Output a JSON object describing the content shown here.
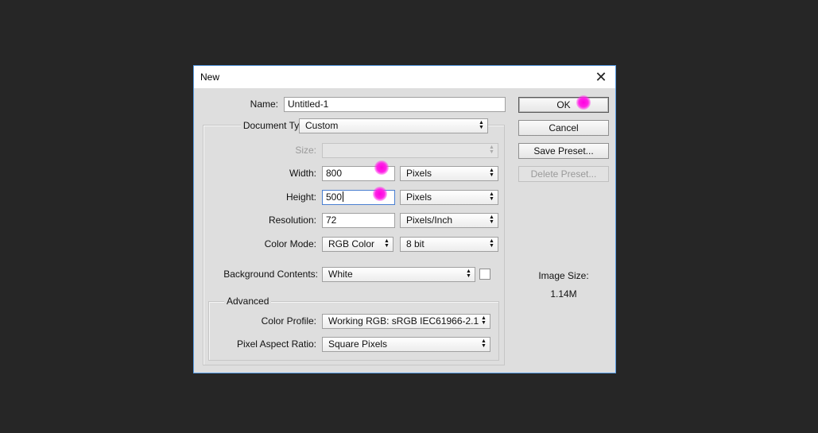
{
  "dialog": {
    "title": "New",
    "close_glyph": "✕",
    "name_label": "Name:",
    "name_value": "Untitled-1",
    "document_type_label": "Document Type:",
    "document_type_value": "Custom",
    "size_label": "Size:",
    "size_value": "",
    "width_label": "Width:",
    "width_value": "800",
    "width_unit": "Pixels",
    "height_label": "Height:",
    "height_value": "500",
    "height_unit": "Pixels",
    "resolution_label": "Resolution:",
    "resolution_value": "72",
    "resolution_unit": "Pixels/Inch",
    "color_mode_label": "Color Mode:",
    "color_mode_value": "RGB Color",
    "bit_depth_value": "8 bit",
    "background_label": "Background Contents:",
    "background_value": "White",
    "background_swatch_color": "#ffffff",
    "advanced_legend": "Advanced",
    "color_profile_label": "Color Profile:",
    "color_profile_value": "Working RGB:  sRGB IEC61966-2.1",
    "pixel_aspect_label": "Pixel Aspect Ratio:",
    "pixel_aspect_value": "Square Pixels"
  },
  "buttons": {
    "ok": "OK",
    "cancel": "Cancel",
    "save_preset": "Save Preset...",
    "delete_preset": "Delete Preset..."
  },
  "image_size": {
    "label": "Image Size:",
    "value": "1.14M"
  },
  "icons": {
    "dropdown_arrow": "▲▼",
    "click_marker_color": "#ff00e0"
  }
}
